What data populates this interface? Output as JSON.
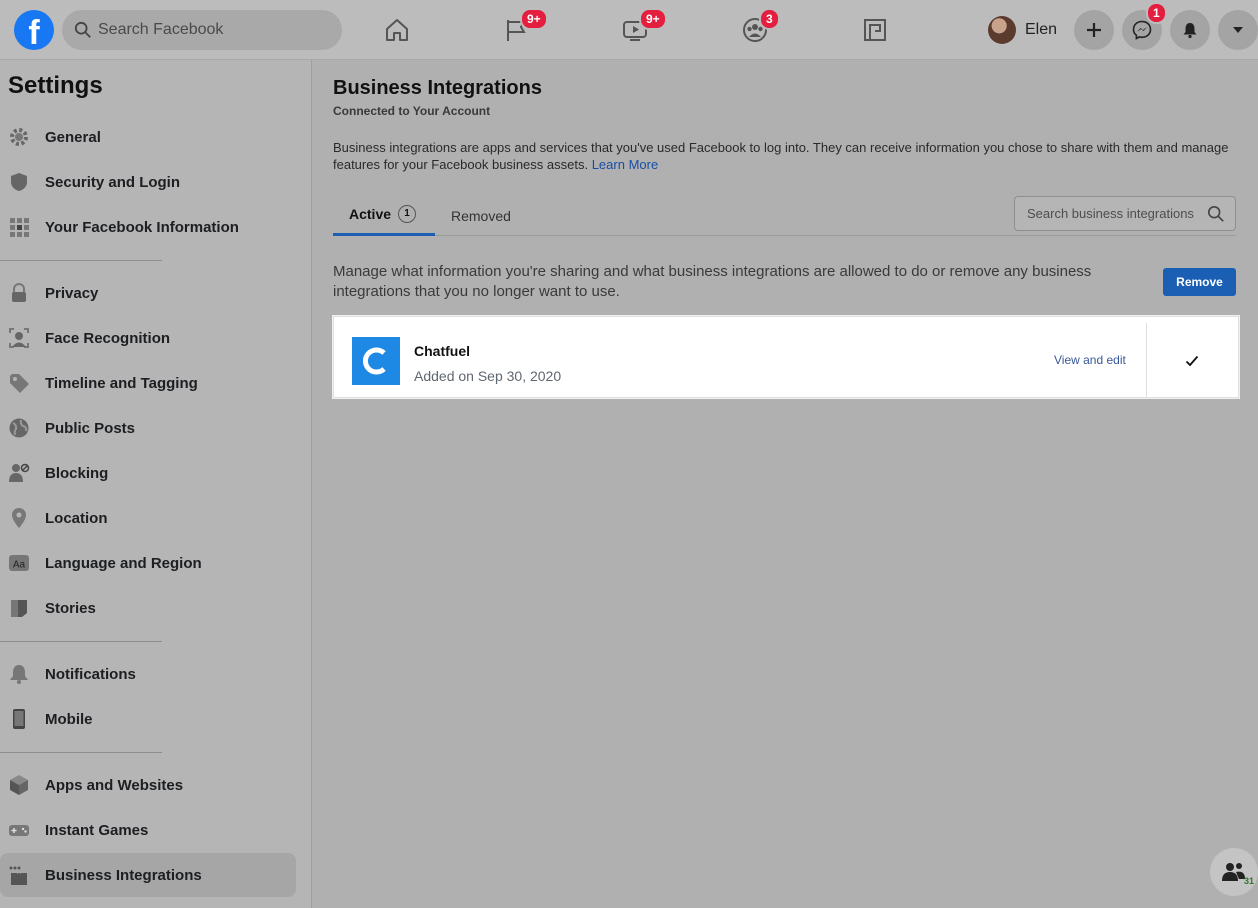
{
  "topbar": {
    "logo_letter": "f",
    "search_placeholder": "Search Facebook",
    "badges": {
      "pages": "9+",
      "watch": "9+",
      "groups": "3",
      "messenger": "1"
    },
    "profile_name": "Elen"
  },
  "sidebar": {
    "title": "Settings",
    "items": [
      {
        "label": "General",
        "icon": "gear-icon"
      },
      {
        "label": "Security and Login",
        "icon": "shield-icon"
      },
      {
        "label": "Your Facebook Information",
        "icon": "grid-icon"
      },
      {
        "label": "Privacy",
        "icon": "lock-icon"
      },
      {
        "label": "Face Recognition",
        "icon": "face-icon"
      },
      {
        "label": "Timeline and Tagging",
        "icon": "tag-icon"
      },
      {
        "label": "Public Posts",
        "icon": "globe-icon"
      },
      {
        "label": "Blocking",
        "icon": "block-user-icon"
      },
      {
        "label": "Location",
        "icon": "location-pin-icon"
      },
      {
        "label": "Language and Region",
        "icon": "language-icon"
      },
      {
        "label": "Stories",
        "icon": "book-icon"
      },
      {
        "label": "Notifications",
        "icon": "bell-icon"
      },
      {
        "label": "Mobile",
        "icon": "phone-icon"
      },
      {
        "label": "Apps and Websites",
        "icon": "cube-icon"
      },
      {
        "label": "Instant Games",
        "icon": "gamepad-icon"
      },
      {
        "label": "Business Integrations",
        "icon": "puzzle-icon"
      }
    ]
  },
  "main": {
    "title": "Business Integrations",
    "subtitle": "Connected to Your Account",
    "description": "Business integrations are apps and services that you've used Facebook to log into. They can receive information you chose to share with them and manage features for your Facebook business assets.",
    "learn_more": "Learn More",
    "tabs": {
      "active_label": "Active",
      "active_count": "1",
      "removed_label": "Removed"
    },
    "search_placeholder": "Search business integrations",
    "manage_text": "Manage what information you're sharing and what business integrations are allowed to do or remove any business integrations that you no longer want to use.",
    "remove_label": "Remove",
    "integration": {
      "logo_letter": "C",
      "name": "Chatfuel",
      "added": "Added on Sep 30, 2020",
      "view_edit": "View and edit",
      "checked": true
    }
  },
  "contacts_count": "31",
  "colors": {
    "accent": "#1a5fb4",
    "badge": "#e41e3f",
    "chatfuel": "#1e88e5"
  }
}
